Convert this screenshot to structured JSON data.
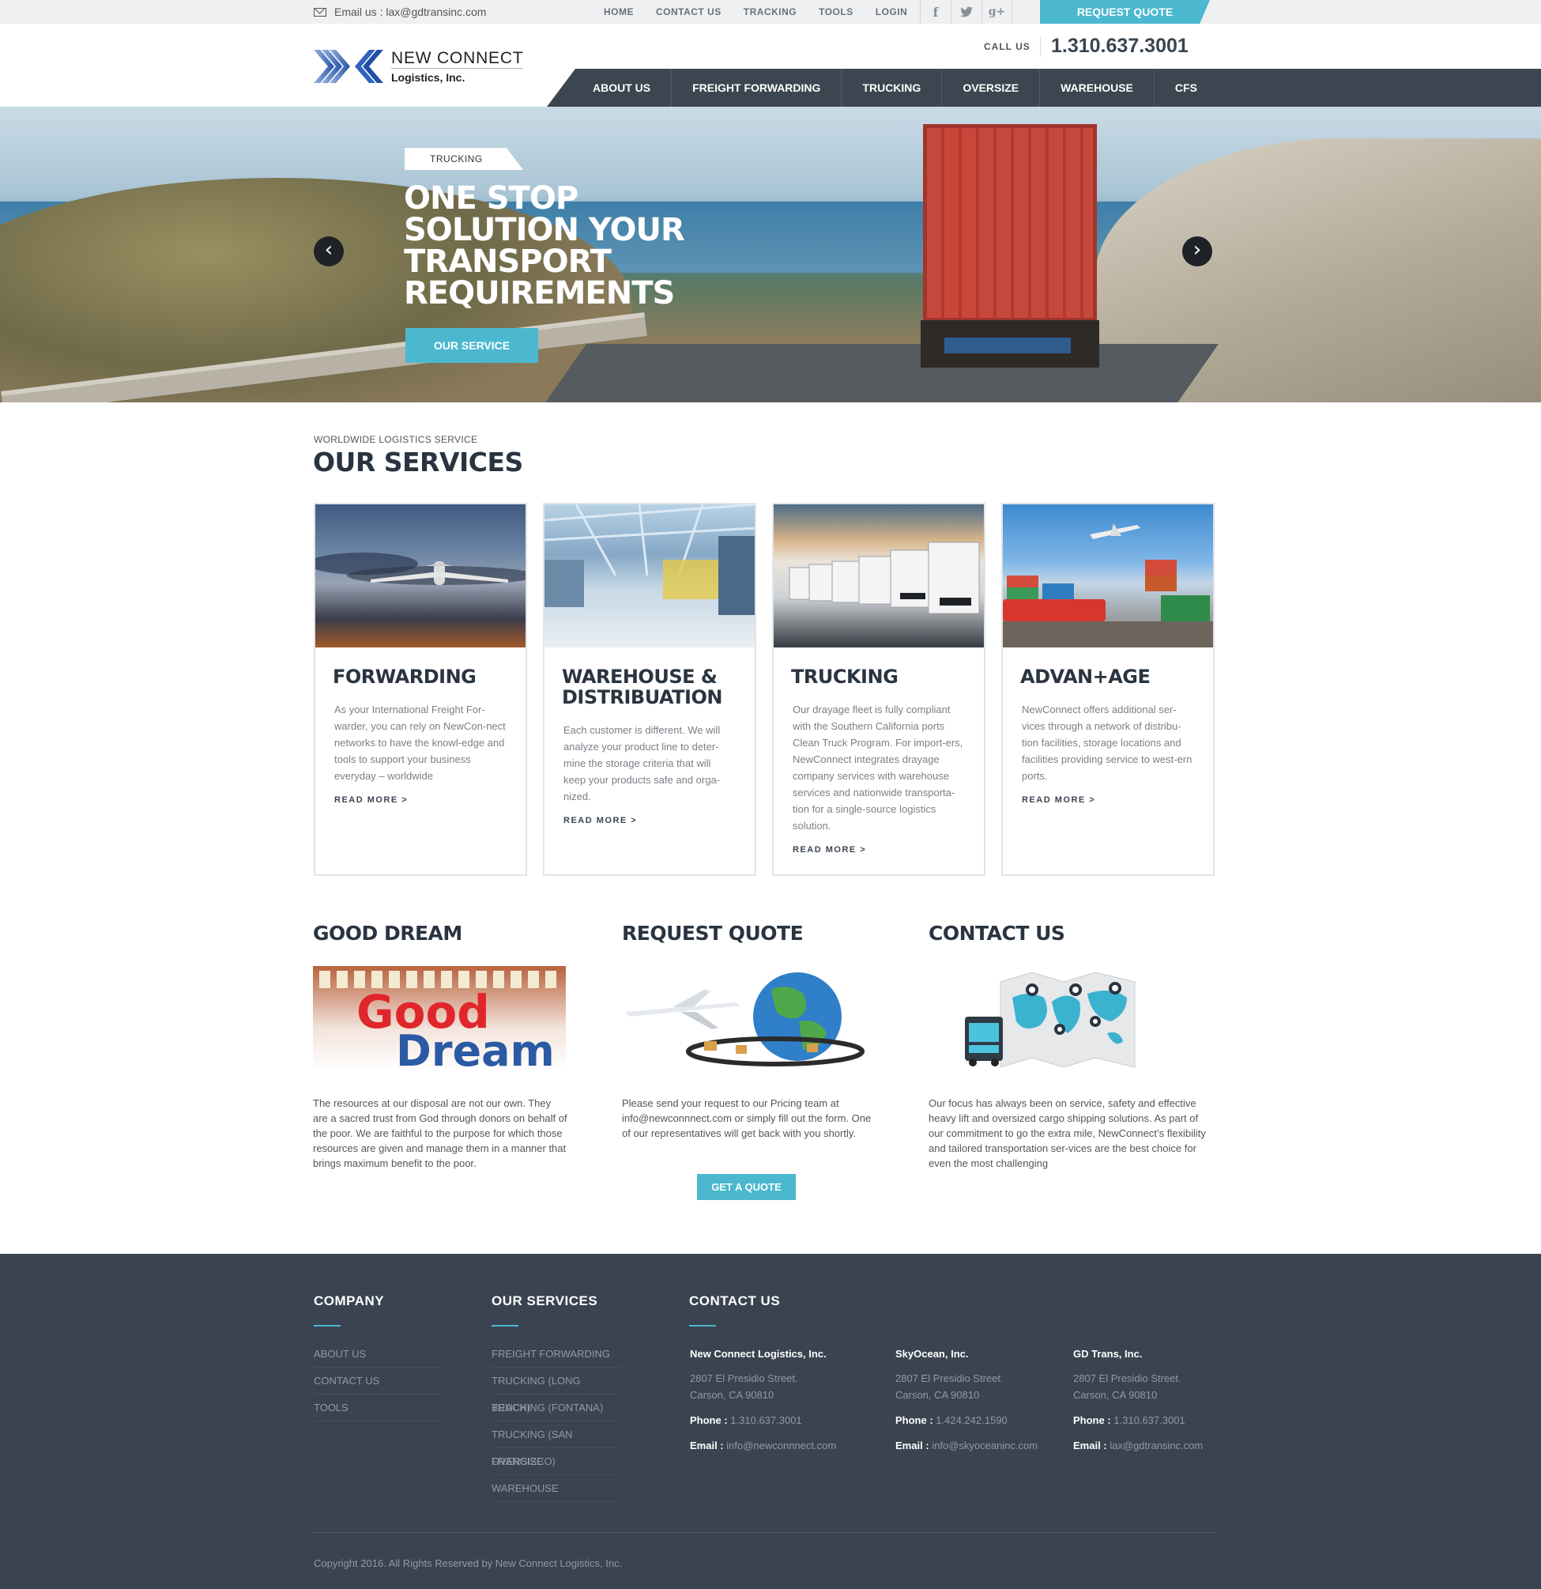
{
  "topbar": {
    "email": "Email us : lax@gdtransinc.com",
    "nav": [
      "HOME",
      "CONTACT US",
      "TRACKING",
      "TOOLS",
      "LOGIN"
    ],
    "social": [
      "facebook-icon",
      "twitter-icon",
      "google-plus-icon"
    ],
    "request_quote": "REQUEST QUOTE"
  },
  "header": {
    "logo_line1": "NEW CONNECT",
    "logo_line2": "Logistics, Inc.",
    "call_us": "CALL US",
    "phone": "1.310.637.3001",
    "nav": [
      "ABOUT US",
      "FREIGHT FORWARDING",
      "TRUCKING",
      "OVERSIZE",
      "WAREHOUSE",
      "CFS"
    ]
  },
  "hero": {
    "tag": "TRUCKING",
    "headline": "ONE STOP SOLUTION YOUR TRANSPORT REQUIREMENTS",
    "button": "OUR SERVICE"
  },
  "services": {
    "kicker": "WORLDWIDE LOGISTICS SERVICE",
    "title": "OUR SERVICES",
    "cards": [
      {
        "title": "FORWARDING",
        "text": "As your International Freight For-warder, you can rely on NewCon-nect networks to have the knowl-edge and tools to support your business everyday – worldwide",
        "more": "READ MORE >"
      },
      {
        "title": "WAREHOUSE & DISTRIBUATION",
        "text": "Each customer is different.  We will analyze your product line to deter-mine the storage criteria that will keep your products safe and orga-nized.",
        "more": "READ MORE >"
      },
      {
        "title": "TRUCKING",
        "text": "Our drayage fleet is fully compliant with the Southern California ports Clean Truck Program.  For import-ers, NewConnect integrates drayage company services with warehouse services and nationwide transporta-tion for a single-source logistics solution.",
        "more": "READ MORE >"
      },
      {
        "title": "ADVAN+AGE",
        "text": "NewConnect offers additional ser-vices through a network of distribu-tion facilities, storage locations and facilities providing service to west-ern ports.",
        "more": "READ MORE >"
      }
    ]
  },
  "columns": {
    "good_dream": {
      "title": "GOOD DREAM",
      "logo_word1": "Good",
      "logo_word2": "Dream",
      "text": "The resources at our disposal are not our own. They are a sacred trust from God through donors on behalf of the poor. We are faithful to the purpose for which those resources are given and manage them in a manner that brings maximum benefit to the poor."
    },
    "request_quote": {
      "title": "REQUEST QUOTE",
      "text": "Please send your request to our Pricing team at info@newconnnect.com or simply fill out the form. One of our representatives will get back with you shortly.",
      "button": "GET A QUOTE"
    },
    "contact": {
      "title": "CONTACT US",
      "text": "Our focus has always been on service, safety and effective heavy lift and oversized cargo shipping solutions. As part of our commitment to go the extra mile, NewConnect’s flexibility and tailored transportation ser-vices are the best choice for even the most challenging"
    }
  },
  "footer": {
    "company": {
      "title": "COMPANY",
      "links": [
        "ABOUT US",
        "CONTACT US",
        "TOOLS"
      ]
    },
    "services": {
      "title": "OUR SERVICES",
      "links": [
        "FREIGHT FORWARDING",
        "TRUCKING (LONG BEACH)",
        "TRUCKING (FONTANA)",
        "TRUCKING (SAN FRANCISCO)",
        "OVERSIZE",
        "WAREHOUSE"
      ]
    },
    "contact": {
      "title": "CONTACT US"
    },
    "offices": [
      {
        "name": "New Connect Logistics, Inc.",
        "street": "2807 El Presidio Street.",
        "city": "Carson, CA 90810",
        "phone_label": "Phone :",
        "phone": "1.310.637.3001",
        "email_label": "Email :",
        "email": "info@newconnnect.com"
      },
      {
        "name": "SkyOcean, Inc.",
        "street": "2807 El Presidio Street.",
        "city": "Carson, CA 90810",
        "phone_label": "Phone :",
        "phone": "1.424.242.1590",
        "email_label": "Email :",
        "email": "info@skyoceaninc.com"
      },
      {
        "name": "GD Trans, Inc.",
        "street": "2807 El Presidio Street.",
        "city": "Carson, CA 90810",
        "phone_label": "Phone :",
        "phone": "1.310.637.3001",
        "email_label": "Email :",
        "email": "lax@gdtransinc.com"
      }
    ],
    "copyright": "Copyright 2016. All Rights Reserved by New Connect Logistics, Inc."
  },
  "colors": {
    "accent": "#4bb8cf",
    "nav_dark": "#3b4651",
    "footer": "#394450",
    "heading": "#2a3440"
  }
}
